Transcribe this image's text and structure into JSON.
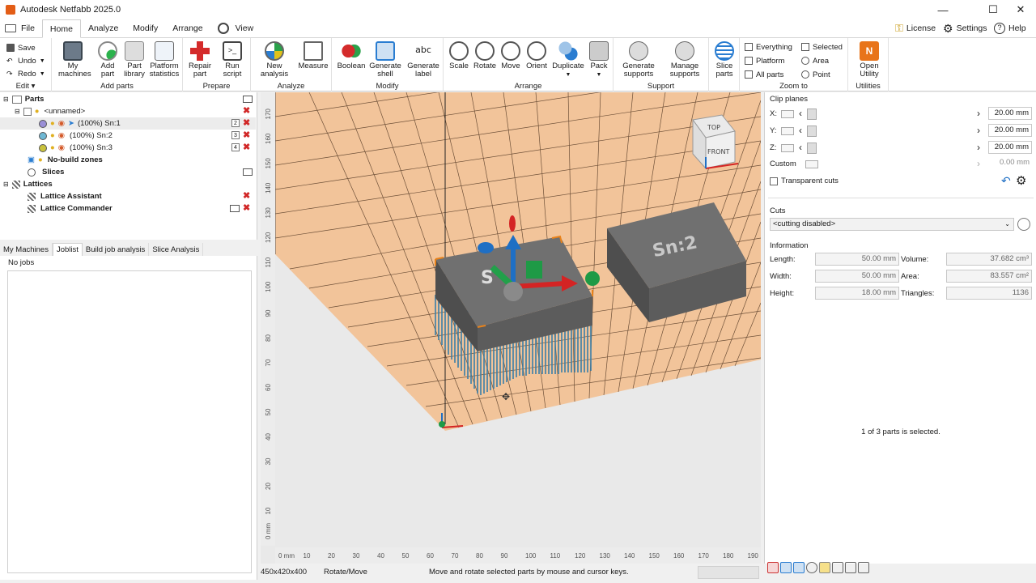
{
  "window": {
    "title": "Autodesk Netfabb 2025.0"
  },
  "menu": {
    "items": [
      "File",
      "Home",
      "Analyze",
      "Modify",
      "Arrange",
      "View"
    ],
    "right": {
      "license": "License",
      "settings": "Settings",
      "help": "Help"
    }
  },
  "ribbon": {
    "edit": {
      "save": "Save",
      "undo": "Undo",
      "redo": "Redo",
      "label": "Edit"
    },
    "add_parts": {
      "my_machines": "My machines",
      "add_part": "Add part",
      "part_library": "Part library",
      "platform_statistics": "Platform statistics",
      "label": "Add parts"
    },
    "prepare": {
      "repair": "Repair part",
      "run_script": "Run script",
      "label": "Prepare"
    },
    "analyze": {
      "new_analysis": "New analysis",
      "measure": "Measure",
      "label": "Analyze"
    },
    "modify": {
      "boolean": "Boolean",
      "generate_shell": "Generate shell",
      "generate_label": "Generate label",
      "label": "Modify"
    },
    "arrange": {
      "scale": "Scale",
      "rotate": "Rotate",
      "move": "Move",
      "orient": "Orient",
      "duplicate": "Duplicate",
      "pack": "Pack",
      "label": "Arrange"
    },
    "support": {
      "generate": "Generate supports",
      "manage": "Manage supports",
      "label": "Support"
    },
    "slice": {
      "slice_parts": "Slice parts"
    },
    "zoom": {
      "everything": "Everything",
      "selected": "Selected",
      "platform": "Platform",
      "area": "Area",
      "all_parts": "All parts",
      "point": "Point",
      "label": "Zoom to"
    },
    "utilities": {
      "open_utility": "Open Utility",
      "label": "Utilities"
    }
  },
  "tree": {
    "parts": "Parts",
    "group": "<unnamed>",
    "items": [
      {
        "label": "(100%) Sn:1",
        "num": "2",
        "color": "#9a8fd6"
      },
      {
        "label": "(100%) Sn:2",
        "num": "3",
        "color": "#6fb8d4"
      },
      {
        "label": "(100%) Sn:3",
        "num": "4",
        "color": "#c9c23c"
      }
    ],
    "no_build": "No-build zones",
    "slices": "Slices",
    "lattices": "Lattices",
    "lattice_assistant": "Lattice Assistant",
    "lattice_commander": "Lattice Commander"
  },
  "tabs": [
    "My Machines",
    "Joblist",
    "Build job analysis",
    "Slice Analysis"
  ],
  "jobs": {
    "empty": "No jobs"
  },
  "viewport": {
    "part2_label": "Sn:2",
    "cube_top": "TOP",
    "cube_front": "FRONT",
    "x_ticks": [
      "0 mm",
      "10",
      "20",
      "30",
      "40",
      "50",
      "60",
      "70",
      "80",
      "90",
      "100",
      "110",
      "120",
      "130",
      "140",
      "150",
      "160",
      "170",
      "180",
      "190"
    ],
    "y_ticks": [
      "0 mm",
      "10",
      "20",
      "30",
      "40",
      "50",
      "60",
      "70",
      "80",
      "90",
      "100",
      "110",
      "120",
      "130",
      "140",
      "150",
      "160",
      "170"
    ]
  },
  "status": {
    "size": "450x420x400",
    "mode": "Rotate/Move",
    "hint": "Move and rotate selected parts by mouse and cursor keys."
  },
  "right": {
    "clip_planes": "Clip planes",
    "x": "X:",
    "y": "Y:",
    "z": "Z:",
    "custom": "Custom",
    "x_val": "20.00 mm",
    "y_val": "20.00 mm",
    "z_val": "20.00 mm",
    "custom_val": "0.00 mm",
    "transparent": "Transparent cuts",
    "cuts": "Cuts",
    "cuts_value": "<cutting disabled>",
    "information": "Information",
    "length_l": "Length:",
    "length": "50.00 mm",
    "width_l": "Width:",
    "width": "50.00 mm",
    "height_l": "Height:",
    "height": "18.00 mm",
    "volume_l": "Volume:",
    "volume": "37.682 cm³",
    "area_l": "Area:",
    "area": "83.557 cm²",
    "triangles_l": "Triangles:",
    "triangles": "1136",
    "selection": "1 of 3 parts is selected."
  }
}
